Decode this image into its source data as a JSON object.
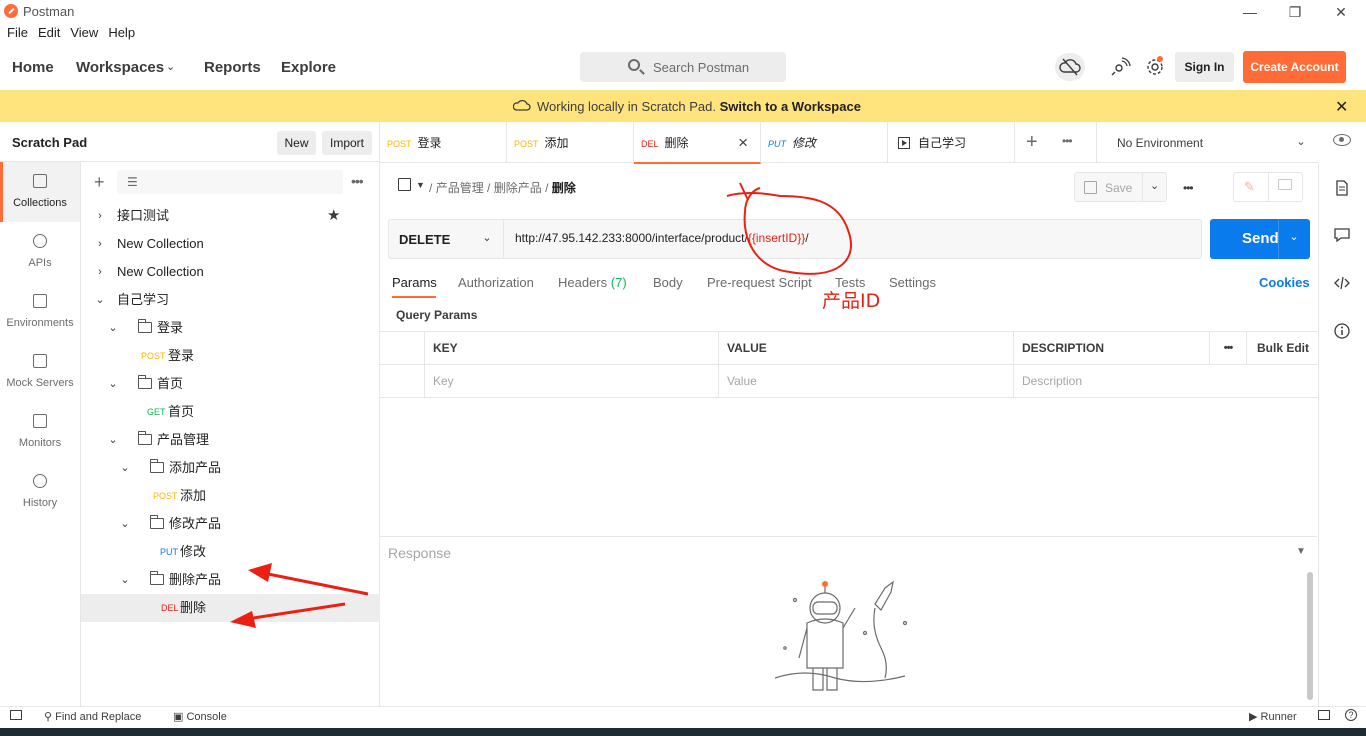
{
  "window": {
    "title": "Postman",
    "minimize": "—",
    "maximize": "❐",
    "close": "✕"
  },
  "menu": [
    "File",
    "Edit",
    "View",
    "Help"
  ],
  "nav": {
    "home": "Home",
    "workspaces": "Workspaces",
    "reports": "Reports",
    "explore": "Explore"
  },
  "search": {
    "placeholder": "Search Postman"
  },
  "account": {
    "sign_in": "Sign In",
    "create": "Create Account"
  },
  "banner": {
    "text": "Working locally in Scratch Pad.",
    "link": "Switch to a Workspace"
  },
  "workspace": {
    "name": "Scratch Pad",
    "new": "New",
    "import": "Import"
  },
  "rail": [
    {
      "label": "Collections",
      "icon": "collections-icon"
    },
    {
      "label": "APIs",
      "icon": "apis-icon"
    },
    {
      "label": "Environments",
      "icon": "environments-icon"
    },
    {
      "label": "Mock Servers",
      "icon": "mock-servers-icon"
    },
    {
      "label": "Monitors",
      "icon": "monitors-icon"
    },
    {
      "label": "History",
      "icon": "history-icon"
    }
  ],
  "tree": [
    {
      "label": "接口测试"
    },
    {
      "label": "New Collection"
    },
    {
      "label": "New Collection"
    },
    {
      "label": "自己学习"
    },
    {
      "label": "登录"
    },
    {
      "method": "POST",
      "label": "登录"
    },
    {
      "label": "首页"
    },
    {
      "method": "GET",
      "label": "首页"
    },
    {
      "label": "产品管理"
    },
    {
      "label": "添加产品"
    },
    {
      "method": "POST",
      "label": "添加"
    },
    {
      "label": "修改产品"
    },
    {
      "method": "PUT",
      "label": "修改"
    },
    {
      "label": "删除产品"
    },
    {
      "method": "DEL",
      "label": "删除"
    }
  ],
  "tabs": [
    {
      "method": "POST",
      "label": "登录"
    },
    {
      "method": "POST",
      "label": "添加"
    },
    {
      "method": "DEL",
      "label": "删除"
    },
    {
      "method": "PUT",
      "label": "修改"
    },
    {
      "label": "自己学习"
    }
  ],
  "environment": {
    "label": "No Environment"
  },
  "breadcrumb": {
    "part1": "产品管理",
    "sep": "/",
    "part2": "删除产品",
    "current": "删除"
  },
  "save": {
    "label": "Save"
  },
  "request": {
    "method": "DELETE",
    "url_prefix": "http://47.95.142.233:8000/interface/product/",
    "url_var": "{{insertID}}",
    "url_suffix": "/",
    "send": "Send"
  },
  "req_tabs": {
    "params": "Params",
    "auth": "Authorization",
    "headers": "Headers",
    "headers_count": "(7)",
    "body": "Body",
    "prerequest": "Pre-request Script",
    "tests": "Tests",
    "settings": "Settings",
    "cookies": "Cookies"
  },
  "query_params": {
    "title": "Query Params",
    "headers": {
      "key": "KEY",
      "value": "VALUE",
      "description": "DESCRIPTION",
      "bulk_edit": "Bulk Edit"
    },
    "placeholders": {
      "key": "Key",
      "value": "Value",
      "description": "Description"
    }
  },
  "response": {
    "label": "Response"
  },
  "statusbar": {
    "find": "Find and Replace",
    "console": "Console",
    "runner": "Runner"
  },
  "annotation": {
    "label": "产品ID",
    "color": "#eb2013"
  },
  "colors": {
    "accent": "#ff6c37",
    "send": "#097bed",
    "banner": "#ffe47e"
  }
}
